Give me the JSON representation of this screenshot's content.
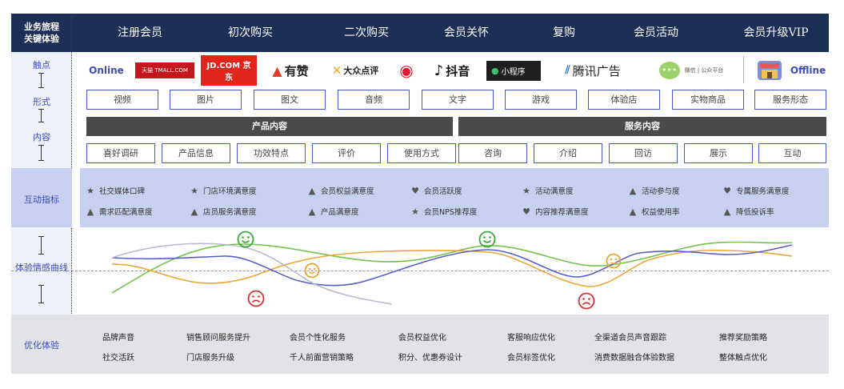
{
  "header": {
    "first_label": "业务旅程\n关键体验",
    "stages": [
      "注册会员",
      "初次购买",
      "二次购买",
      "会员关怀",
      "复购",
      "会员活动",
      "会员升级VIP"
    ]
  },
  "left_labels": {
    "touchpoint": "触点",
    "form": "形式",
    "content": "内容",
    "interaction": "互动指标",
    "curve": "体验情感曲线",
    "optimize": "优化体验"
  },
  "touchpoints": {
    "online": "Online",
    "offline": "Offline",
    "logos": [
      {
        "name": "tmall-logo",
        "text": "天猫 TMALL.COM",
        "bg": "#c4161c",
        "color": "#ffffff"
      },
      {
        "name": "jd-logo",
        "text": "JD.COM 京东",
        "bg": "#e1251b",
        "color": "#ffffff"
      },
      {
        "name": "youzan-logo",
        "text": "有赞",
        "bg": "#ffffff",
        "color": "#222222"
      },
      {
        "name": "dianping-logo",
        "text": "大众点评",
        "bg": "#ffffff",
        "color": "#222222"
      },
      {
        "name": "weibo-logo",
        "text": "",
        "bg": "#ffffff",
        "color": "#e6162d"
      },
      {
        "name": "douyin-logo",
        "text": "抖音",
        "bg": "#ffffff",
        "color": "#111111"
      },
      {
        "name": "miniprogram-logo",
        "text": "小程序",
        "bg": "#1f1f1f",
        "color": "#ffffff"
      },
      {
        "name": "tencent-ads-logo",
        "text": "腾讯广告",
        "bg": "#ffffff",
        "color": "#222222"
      },
      {
        "name": "wechat-logo",
        "text": "微信 | 公众平台",
        "bg": "#ffffff",
        "color": "#555555"
      }
    ]
  },
  "forms": [
    "视频",
    "图片",
    "图文",
    "音频",
    "文字",
    "游戏",
    "体验店",
    "实物商品",
    "服务形态"
  ],
  "content_headers": {
    "product": "产品内容",
    "service": "服务内容"
  },
  "contents": [
    "喜好调研",
    "产品信息",
    "功效特点",
    "评价",
    "使用方式",
    "咨询",
    "介绍",
    "回访",
    "展示",
    "互动"
  ],
  "metrics_row1": [
    {
      "icon": "star-icon",
      "label": "社交媒体口碑"
    },
    {
      "icon": "star-icon",
      "label": "门店环境满意度"
    },
    {
      "icon": "thumbs-up-icon",
      "label": "会员权益满意度"
    },
    {
      "icon": "heart-icon",
      "label": "会员活跃度"
    },
    {
      "icon": "star-icon",
      "label": "活动满意度"
    },
    {
      "icon": "thumbs-up-icon",
      "label": "活动参与度"
    },
    {
      "icon": "heart-icon",
      "label": "专属服务满意度"
    }
  ],
  "metrics_row2": [
    {
      "icon": "thumbs-up-icon",
      "label": "需求匹配满意度"
    },
    {
      "icon": "thumbs-up-icon",
      "label": "店员服务满意度"
    },
    {
      "icon": "thumbs-up-icon",
      "label": "产品满意度"
    },
    {
      "icon": "star-icon",
      "label": "会员NPS推荐度"
    },
    {
      "icon": "heart-icon",
      "label": "内容推荐满意度"
    },
    {
      "icon": "thumbs-up-icon",
      "label": "权益使用率"
    },
    {
      "icon": "thumbs-up-icon",
      "label": "降低投诉率"
    }
  ],
  "curve_colors": {
    "green": "#72c44a",
    "orange": "#e9a63a",
    "purple": "#5a5fc8",
    "grey": "#b9b9c9"
  },
  "optimize_row1": [
    "品牌声音",
    "销售顾问服务提升",
    "会员个性化服务",
    "会员权益优化",
    "客服响应优化",
    "全渠道会员声音跟踪",
    "推荐奖励策略"
  ],
  "optimize_row2": [
    "社交活跃",
    "门店服务升级",
    "千人前面营销策略",
    "积分、优惠券设计",
    "会员标签优化",
    "消费数据融合体验数据",
    "整体触点优化"
  ]
}
